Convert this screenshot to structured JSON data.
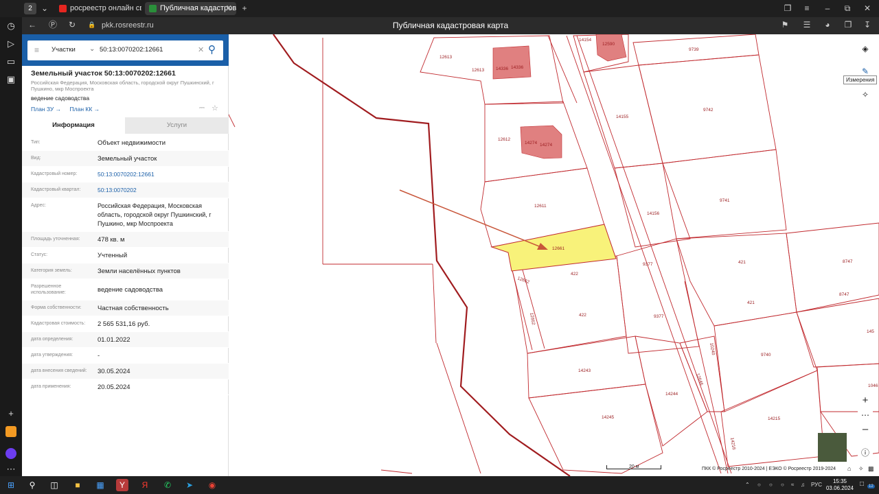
{
  "browser": {
    "tab_counter": "2",
    "tabs": [
      {
        "label": "росреестр онлайн сведе",
        "favicon_color": "#e52620"
      },
      {
        "label": "Публичная кадастрова",
        "favicon_color": "#2a8f3a"
      }
    ],
    "url": "pkk.rosreestr.ru",
    "page_title": "Публичная кадастровая карта"
  },
  "search": {
    "type_label": "Участки",
    "query": "50:13:0070202:12661"
  },
  "parcel": {
    "title": "Земельный участок 50:13:0070202:12661",
    "address_short": "Российская Федерация, Московская область, городской округ Пушкинский, г Пушкино, мкр Моспроекта",
    "purpose": "ведение садоводства",
    "plan_zu": "План ЗУ →",
    "plan_kk": "План КК →"
  },
  "info_tabs": {
    "info": "Информация",
    "services": "Услуги"
  },
  "fields": [
    {
      "key": "Тип:",
      "value": "Объект недвижимости",
      "link": false
    },
    {
      "key": "Вид:",
      "value": "Земельный участок",
      "link": false
    },
    {
      "key": "Кадастровый номер:",
      "value": "50:13:0070202:12661",
      "link": true
    },
    {
      "key": "Кадастровый квартал:",
      "value": "50:13:0070202",
      "link": true
    },
    {
      "key": "Адрес:",
      "value": "Российская Федерация, Московская область, городской округ Пушкинский, г Пушкино, мкр Моспроекта",
      "link": false
    },
    {
      "key": "Площадь уточненная:",
      "value": "478 кв. м",
      "link": false
    },
    {
      "key": "Статус:",
      "value": "Учтенный",
      "link": false
    },
    {
      "key": "Категория земель:",
      "value": "Земли населённых пунктов",
      "link": false
    },
    {
      "key": "Разрешенное использование:",
      "value": "ведение садоводства",
      "link": false
    },
    {
      "key": "Форма собственности:",
      "value": "Частная собственность",
      "link": false
    },
    {
      "key": "Кадастровая стоимость:",
      "value": "2 565 531,16 руб.",
      "link": false
    },
    {
      "key": "дата определения:",
      "value": "01.01.2022",
      "link": false
    },
    {
      "key": "дата утверждения:",
      "value": "-",
      "link": false
    },
    {
      "key": "дата внесения сведений:",
      "value": "30.05.2024",
      "link": false
    },
    {
      "key": "дата применения:",
      "value": "20.05.2024",
      "link": false
    }
  ],
  "map": {
    "tooltip": "Измерения",
    "scale": "20 м",
    "copyright": "ПКК © Росреестр 2010-2024 | ЕЭКО © Росреестр 2019-2024",
    "parcel_labels": [
      "12613",
      "12613",
      "14336",
      "14336",
      "14154",
      "12590",
      "9739",
      "14155",
      "9742",
      "12612",
      "14274",
      "14274",
      "12611",
      "14156",
      "9741",
      "12661",
      "422",
      "12662",
      "422",
      "12662",
      "9377",
      "9377",
      "421",
      "421",
      "8747",
      "8747",
      "145",
      "10240",
      "9740",
      "14243",
      "14244",
      "12646",
      "14245",
      "14216",
      "14215",
      "1046"
    ]
  },
  "taskbar": {
    "lang": "РУС",
    "time": "15:35",
    "date": "03.06.2024",
    "notif_count": "12"
  },
  "colors": {
    "selected_parcel": "#f8f27a",
    "boundary": "#c0282d",
    "building": "#e08080",
    "accent": "#1a5fa8"
  }
}
